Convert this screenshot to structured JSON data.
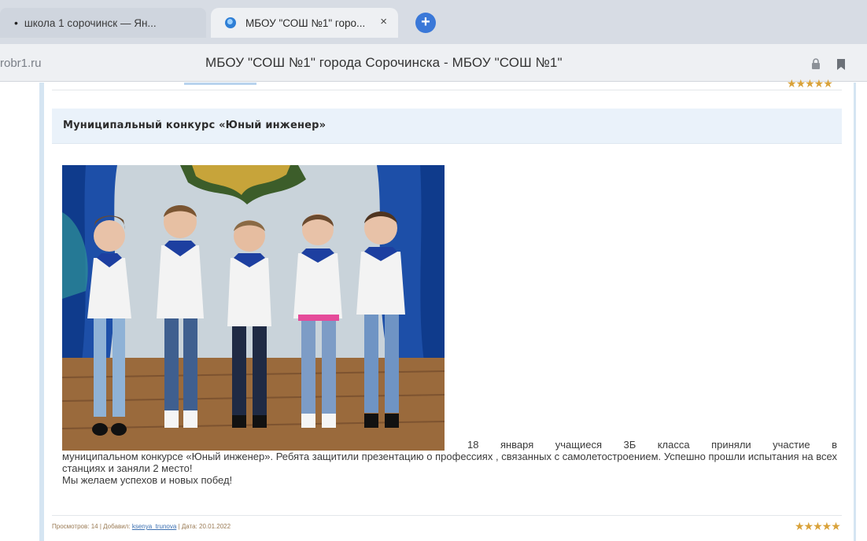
{
  "browser": {
    "tabs": [
      {
        "title": "школа 1 сорочинск — Ян...",
        "modified_marker": "•",
        "active": false
      },
      {
        "title": "МБОУ \"СОШ №1\" горо...",
        "active": true
      }
    ],
    "new_tab_symbol": "+",
    "close_symbol": "×",
    "url": "robr1.ru",
    "page_title": "МБОУ \"СОШ №1\" города Сорочинска - МБОУ \"СОШ №1\""
  },
  "news": {
    "title": "Муниципальный конкурс «Юный инженер»",
    "photo_alt": "photo-of-five-students",
    "text_first": "18 января учащиеся 3Б класса приняли участие в",
    "text_rest": "муниципальном конкурсе «Юный инженер». Ребята защитили презентацию о профессиях , связанных с самолетостроением. Успешно прошли испытания на всех станциях и заняли 2 место!",
    "text_wish": "Мы желаем успехов и новых побед!",
    "meta": {
      "views_label": "Просмотров:",
      "views": "14",
      "added_label": "Добавил:",
      "author": "ksenya_trunova",
      "date_label": "Дата:",
      "date": "20.01.2022"
    },
    "rating": "★★★★★",
    "previous_rating": "★★★★★"
  },
  "colors": {
    "accent_star": "#d9a23a",
    "header_bg": "#eaf2fa",
    "link": "#3b6fb0"
  }
}
